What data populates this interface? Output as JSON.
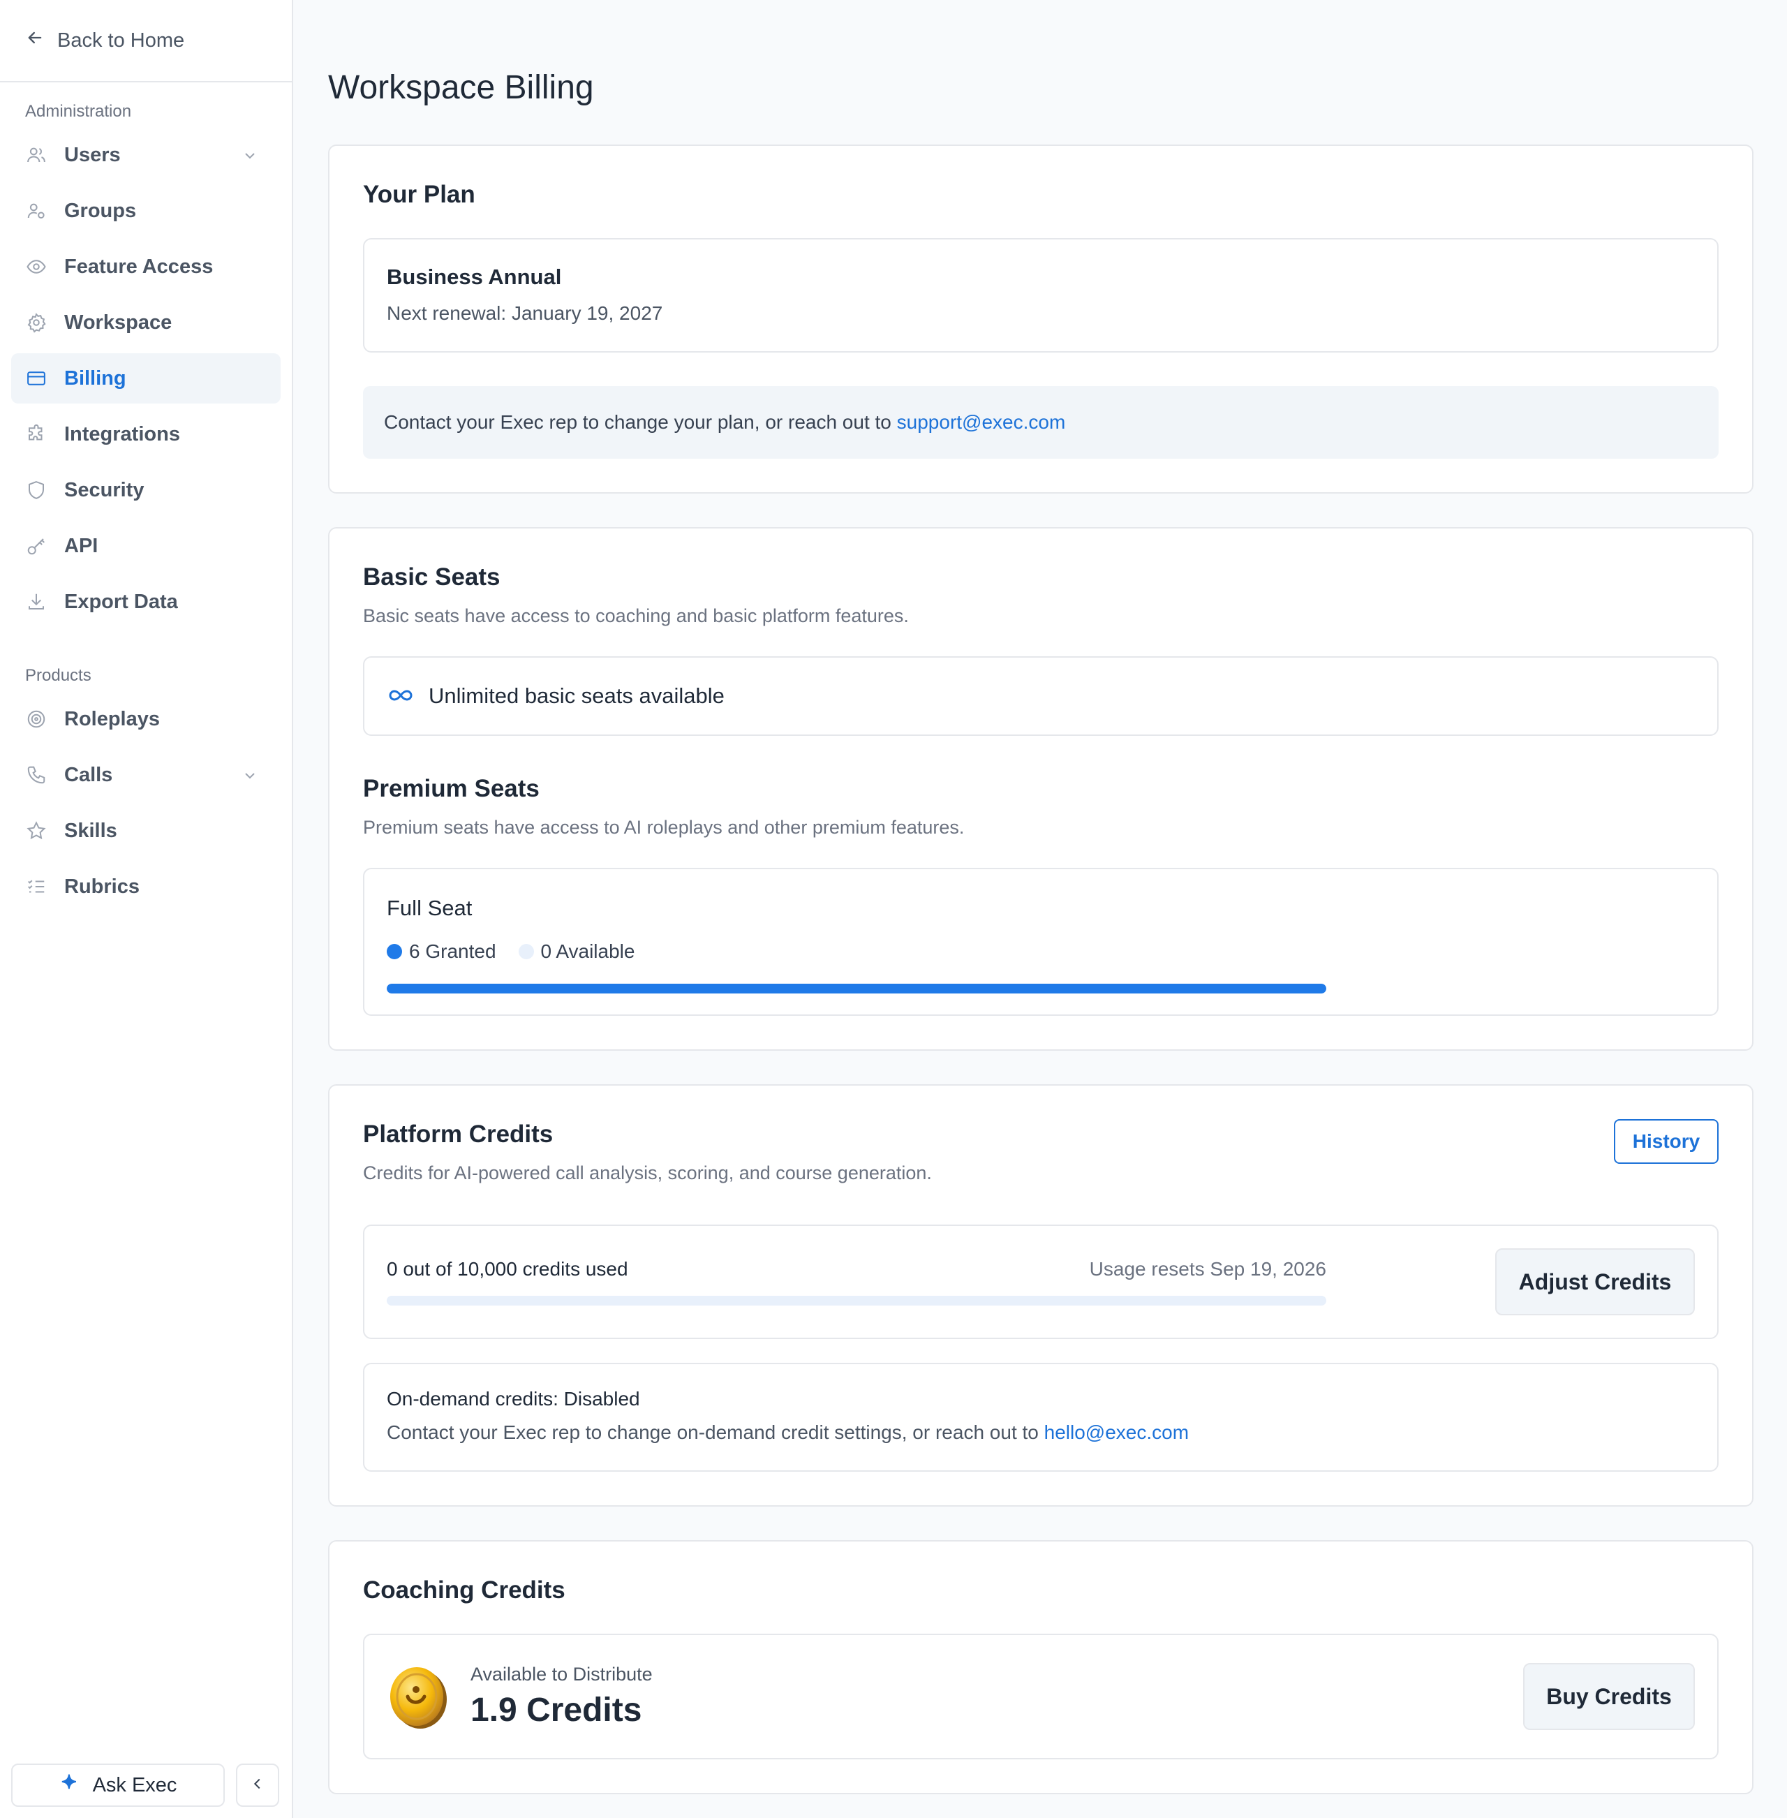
{
  "sidebar": {
    "back_label": "Back to Home",
    "admin_section": "Administration",
    "admin_items": [
      {
        "label": "Users",
        "icon": "users-icon"
      },
      {
        "label": "Groups",
        "icon": "groups-icon"
      },
      {
        "label": "Feature Access",
        "icon": "eye-icon"
      },
      {
        "label": "Workspace",
        "icon": "gear-icon"
      },
      {
        "label": "Billing",
        "icon": "credit-card-icon"
      },
      {
        "label": "Integrations",
        "icon": "puzzle-icon"
      },
      {
        "label": "Security",
        "icon": "shield-icon"
      },
      {
        "label": "API",
        "icon": "key-icon"
      },
      {
        "label": "Export Data",
        "icon": "download-icon"
      }
    ],
    "products_section": "Products",
    "product_items": [
      {
        "label": "Roleplays",
        "icon": "target-icon"
      },
      {
        "label": "Calls",
        "icon": "phone-icon"
      },
      {
        "label": "Skills",
        "icon": "star-icon"
      },
      {
        "label": "Rubrics",
        "icon": "checklist-icon"
      }
    ],
    "active_item": "Billing",
    "ask_label": "Ask Exec"
  },
  "page": {
    "title": "Workspace Billing"
  },
  "plan": {
    "title": "Your Plan",
    "name": "Business Annual",
    "renewal": "Next renewal: January 19, 2027",
    "notice_text": "Contact your Exec rep to change your plan, or reach out to ",
    "notice_link": "support@exec.com"
  },
  "seats": {
    "basic_title": "Basic Seats",
    "basic_sub": "Basic seats have access to coaching and basic platform features.",
    "basic_unlimited": "Unlimited basic seats available",
    "premium_title": "Premium Seats",
    "premium_sub": "Premium seats have access to AI roleplays and other premium features.",
    "full_seat_title": "Full Seat",
    "granted_label": "6 Granted",
    "available_label": "0 Available",
    "granted": 6,
    "available": 0
  },
  "platform_credits": {
    "title": "Platform Credits",
    "sub": "Credits for AI-powered call analysis, scoring, and course generation.",
    "history_label": "History",
    "used_text": "0 out of 10,000 credits used",
    "used": 0,
    "total": 10000,
    "reset_text": "Usage resets Sep 19, 2026",
    "adjust_label": "Adjust Credits",
    "ondemand_title": "On-demand credits: Disabled",
    "ondemand_text": "Contact your Exec rep to change on-demand credit settings, or reach out to ",
    "ondemand_link": "hello@exec.com"
  },
  "coaching": {
    "title": "Coaching Credits",
    "label": "Available to Distribute",
    "value": "1.9 Credits",
    "buy_label": "Buy Credits"
  },
  "colors": {
    "accent": "#1d72d8",
    "progress": "#1f7ae8",
    "track": "#e8f0fb"
  }
}
